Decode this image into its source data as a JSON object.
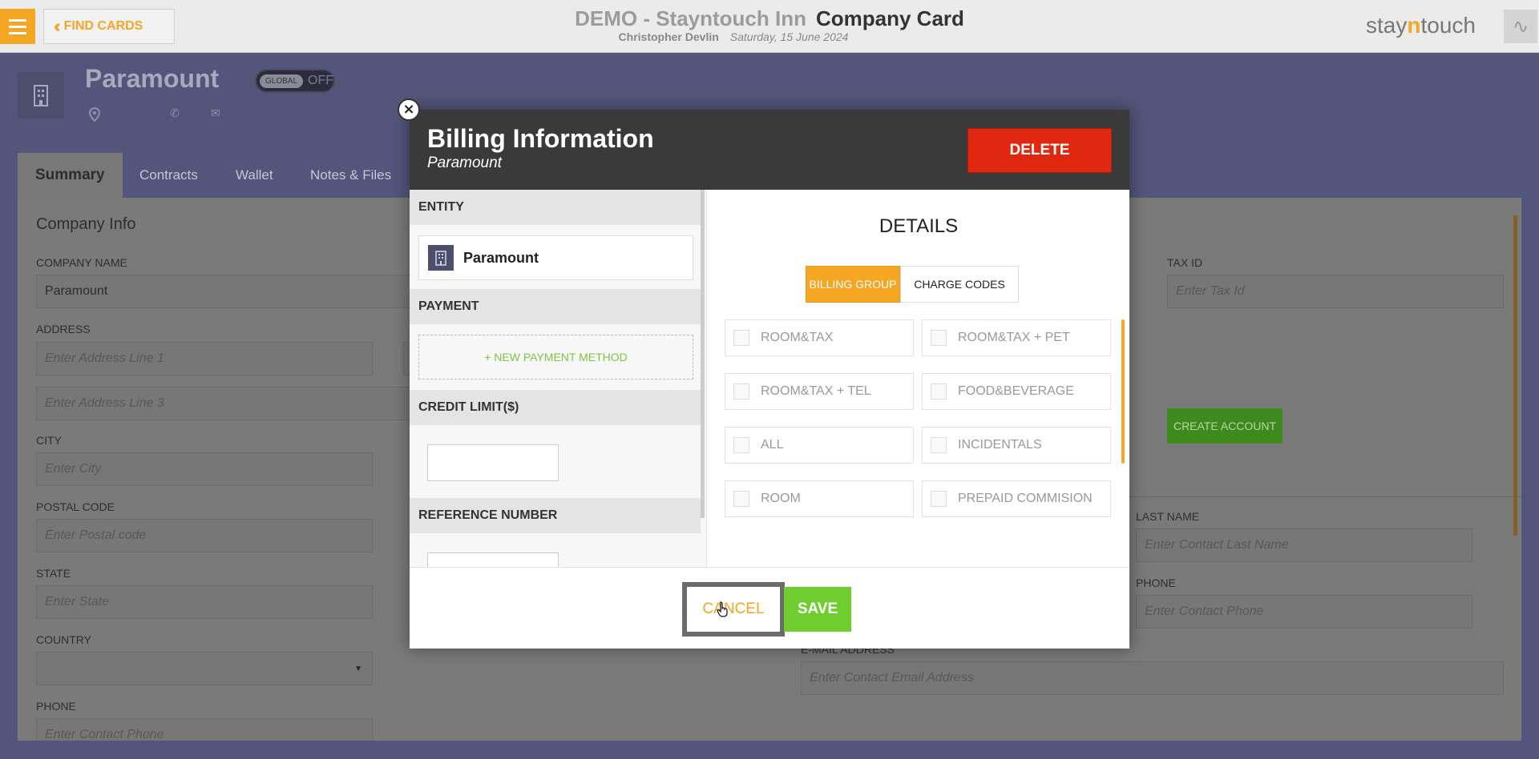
{
  "header": {
    "find_cards_label": "FIND CARDS",
    "hotel": "DEMO - Stayntouch Inn",
    "page_title": "Company Card",
    "user": "Christopher Devlin",
    "date": "Saturday, 15 June 2024",
    "logo_prefix": "stay",
    "logo_accent": "n",
    "logo_suffix": "touch"
  },
  "company": {
    "name": "Paramount",
    "global_knob": "GLOBAL",
    "global_state": "OFF"
  },
  "tabs": [
    {
      "label": "Summary"
    },
    {
      "label": "Contracts"
    },
    {
      "label": "Wallet"
    },
    {
      "label": "Notes & Files"
    }
  ],
  "summary": {
    "section_title": "Company Info",
    "company_name_label": "COMPANY NAME",
    "company_name_value": "Paramount",
    "address_label": "ADDRESS",
    "address1_placeholder": "Enter Address Line 1",
    "address3_placeholder": "Enter Address Line 3",
    "city_label": "CITY",
    "city_placeholder": "Enter City",
    "postal_label": "POSTAL CODE",
    "postal_placeholder": "Enter Postal code",
    "state_label": "STATE",
    "state_placeholder": "Enter State",
    "country_label": "COUNTRY",
    "phone_label": "PHONE",
    "phone_placeholder": "Enter Contact Phone",
    "tax_id_label": "TAX ID",
    "tax_id_placeholder": "Enter Tax Id",
    "create_account_label": "CREATE ACCOUNT",
    "last_name_label": "LAST NAME",
    "last_name_placeholder": "Enter Contact Last Name",
    "contact_phone_label": "PHONE",
    "contact_phone_placeholder": "Enter Contact Phone",
    "email_label": "E-MAIL ADDRESS",
    "email_placeholder": "Enter Contact Email Address"
  },
  "modal": {
    "title": "Billing Information",
    "subtitle": "Paramount",
    "delete_label": "DELETE",
    "entity_header": "ENTITY",
    "entity_name": "Paramount",
    "payment_header": "PAYMENT",
    "new_payment_label": "+ NEW PAYMENT METHOD",
    "credit_limit_header": "CREDIT LIMIT($)",
    "reference_header": "REFERENCE NUMBER",
    "details_title": "DETAILS",
    "seg_billing_group": "BILLING GROUP",
    "seg_charge_codes": "CHARGE CODES",
    "codes": [
      "ROOM&TAX",
      "ROOM&TAX + PET",
      "ROOM&TAX + TEL",
      "FOOD&BEVERAGE",
      "ALL",
      "INCIDENTALS",
      "ROOM",
      "PREPAID COMMISION"
    ],
    "cancel_label": "CANCEL",
    "save_label": "SAVE"
  },
  "colors": {
    "accent": "#f5a623",
    "delete": "#e02810",
    "save": "#6fce2e",
    "header_bg": "#3a3a3a"
  }
}
